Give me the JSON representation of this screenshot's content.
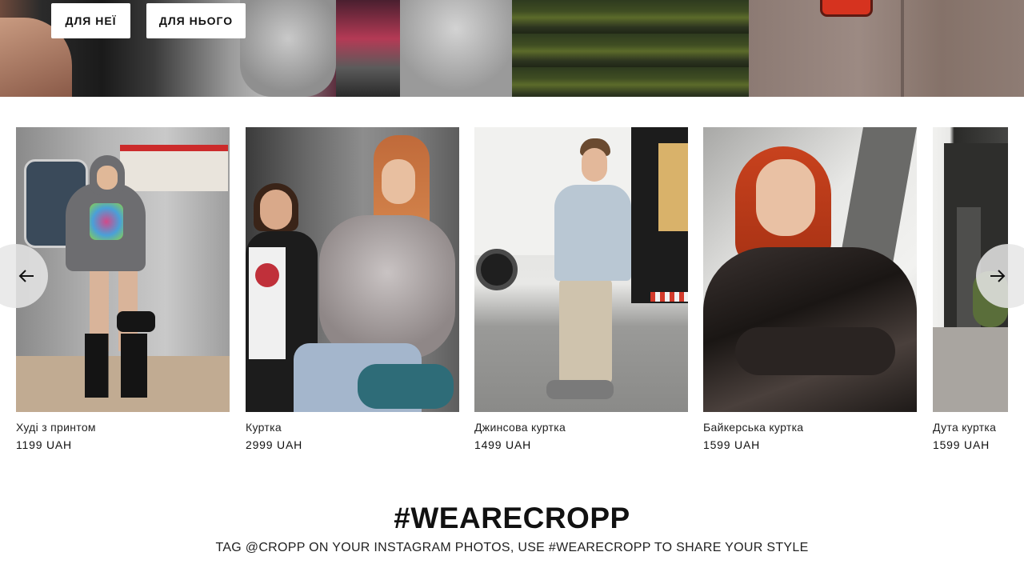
{
  "hero": {
    "buttons": [
      {
        "label": "ДЛЯ НЕЇ"
      },
      {
        "label": "ДЛЯ НЬОГО"
      }
    ]
  },
  "carousel": {
    "prev_icon": "arrow-left-icon",
    "next_icon": "arrow-right-icon",
    "products": [
      {
        "name": "Худі з принтом",
        "price": "1199 UAH"
      },
      {
        "name": "Куртка",
        "price": "2999 UAH"
      },
      {
        "name": "Джинсова куртка",
        "price": "1499 UAH"
      },
      {
        "name": "Байкерська куртка",
        "price": "1599 UAH"
      },
      {
        "name": "Дута куртка",
        "price": "1599 UAH"
      }
    ]
  },
  "social": {
    "title": "#WEARECROPP",
    "subtitle": "TAG @CROPP ON YOUR INSTAGRAM PHOTOS, USE #WEARECROPP TO SHARE YOUR STYLE"
  },
  "colors": {
    "text": "#111111",
    "background": "#ffffff",
    "arrow_bg": "#e6e6e6"
  }
}
